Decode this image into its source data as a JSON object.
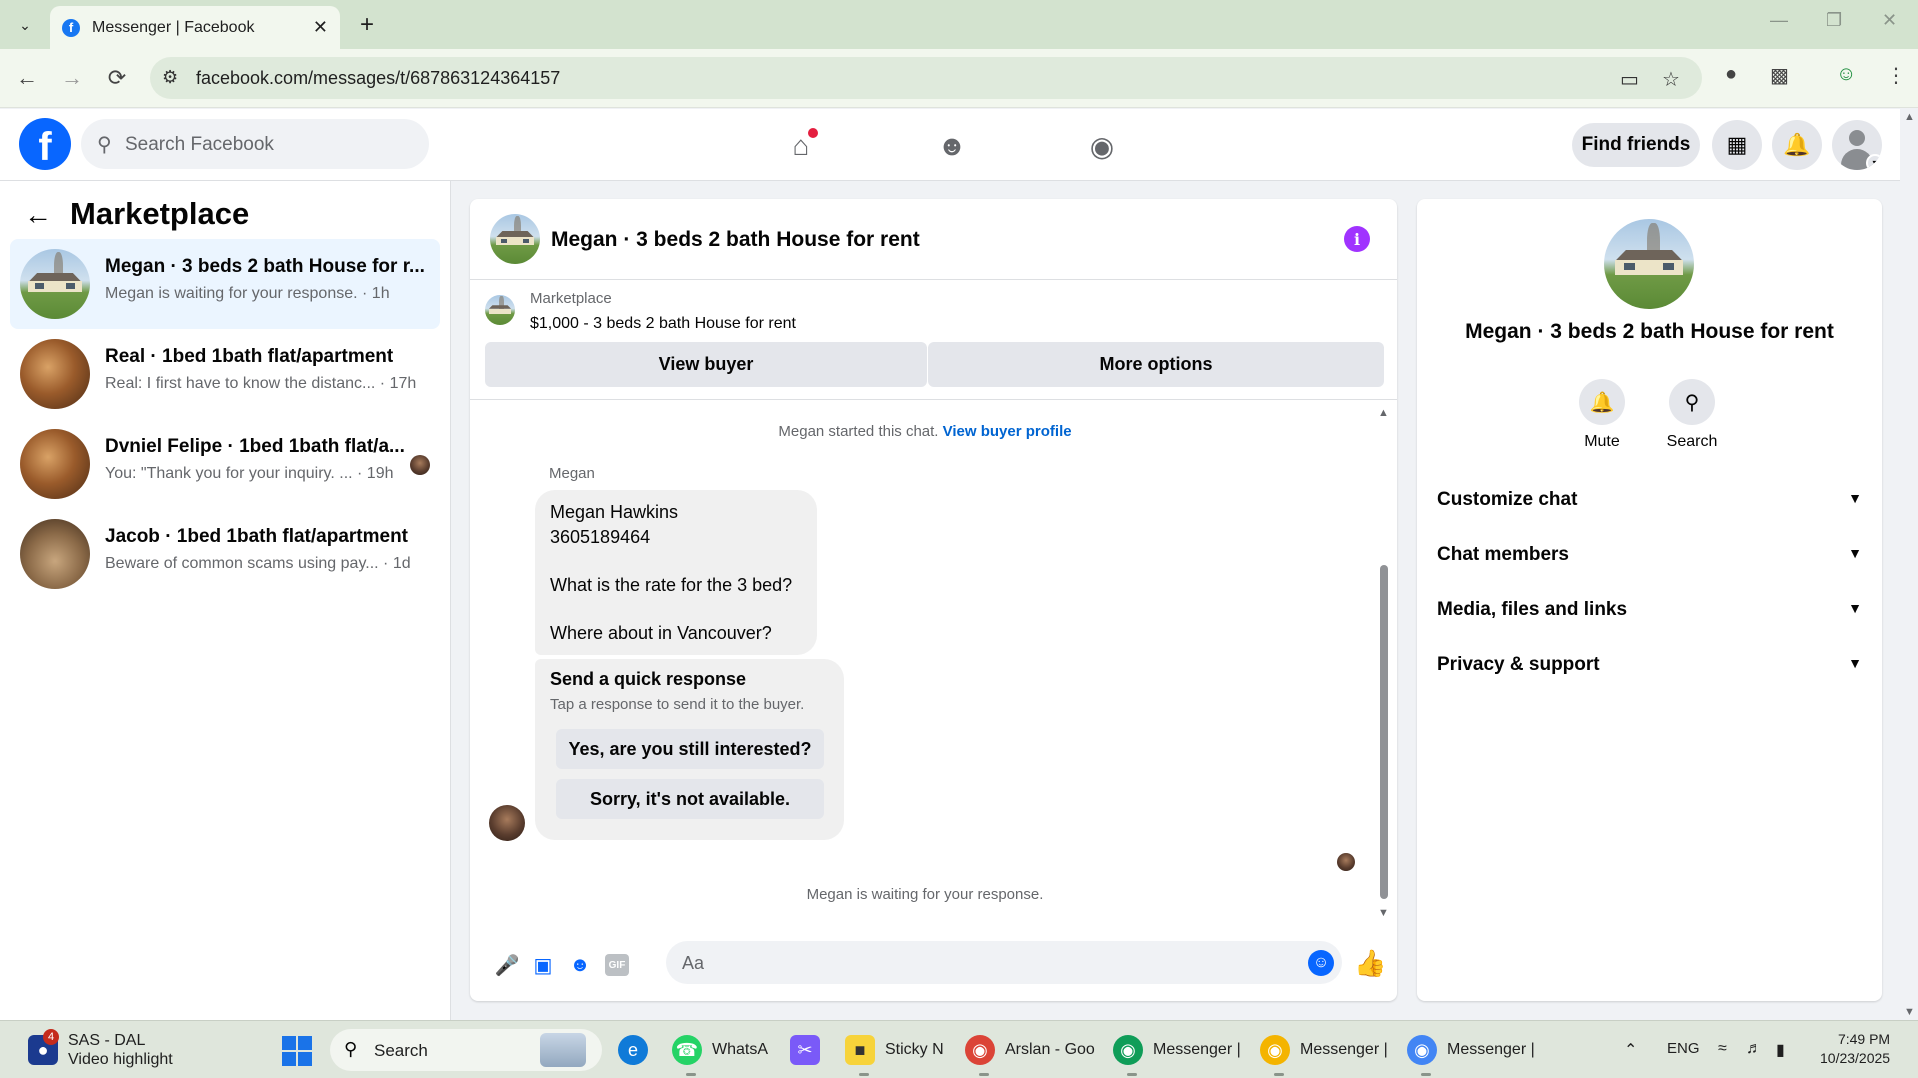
{
  "browser": {
    "tab_title": "Messenger | Facebook",
    "url": "facebook.com/messages/t/687863124364157"
  },
  "fb_header": {
    "search_placeholder": "Search Facebook",
    "find_friends_label": "Find friends"
  },
  "sidebar": {
    "title": "Marketplace",
    "conversations": [
      {
        "name": "Megan · 3 beds 2 bath House for r...",
        "preview": "Megan is waiting for your response. · 1h",
        "active": true
      },
      {
        "name": "Real · 1bed 1bath flat/apartment",
        "preview": "Real: I first have to know the distanc... · 17h"
      },
      {
        "name": "Dvniel Felipe · 1bed 1bath flat/a...",
        "preview": "You: \"Thank you for your inquiry. ... · 19h"
      },
      {
        "name": "Jacob · 1bed 1bath flat/apartment",
        "preview": "Beware of common scams using pay... · 1d"
      }
    ]
  },
  "chat": {
    "title": "Megan · 3 beds 2 bath House for rent",
    "listing_label": "Marketplace",
    "listing_value": "$1,000 - 3 beds 2 bath House for rent",
    "view_buyer_label": "View buyer",
    "more_options_label": "More options",
    "started_text": "Megan started this chat.",
    "view_profile_link": "View buyer profile",
    "sender_name": "Megan",
    "message_lines": [
      "Megan Hawkins",
      "3605189464",
      "",
      "What is the rate for the 3 bed?",
      "",
      "Where about in Vancouver?"
    ],
    "quick_response_title": "Send a quick response",
    "quick_response_subtitle": "Tap a response to send it to the buyer.",
    "quick_replies": [
      "Yes, are you still interested?",
      "Sorry, it's not available."
    ],
    "waiting_text": "Megan is waiting for your response.",
    "composer_placeholder": "Aa"
  },
  "info_panel": {
    "name": "Megan · 3 beds 2 bath House for rent",
    "mute_label": "Mute",
    "search_label": "Search",
    "sections": [
      "Customize chat",
      "Chat members",
      "Media, files and links",
      "Privacy & support"
    ]
  },
  "taskbar": {
    "weather_title": "SAS - DAL",
    "weather_subtitle": "Video highlight",
    "weather_badge": "4",
    "search_placeholder": "Search",
    "apps": [
      "WhatsA",
      "Sticky N",
      "Arslan - Goo",
      "Messenger |",
      "Messenger |",
      "Messenger |"
    ],
    "language": "ENG",
    "time": "7:49 PM",
    "date": "10/23/2025"
  },
  "colors": {
    "accent": "#0866ff",
    "info_icon": "#a033ff",
    "active_conversation": "#ebf5ff",
    "link": "#0064d1"
  }
}
